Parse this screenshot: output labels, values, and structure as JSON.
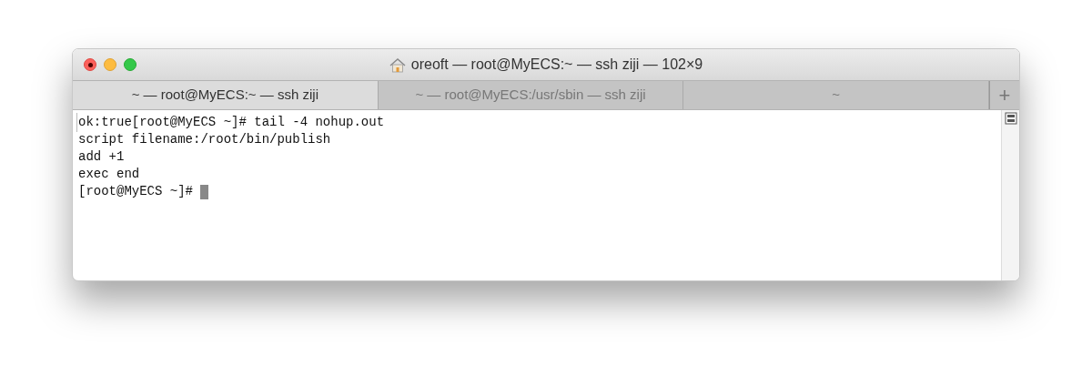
{
  "window": {
    "title": "oreoft — root@MyECS:~ — ssh ziji — 102×9"
  },
  "tabs": [
    {
      "label": "~ — root@MyECS:~ — ssh ziji",
      "selected": true
    },
    {
      "label": "~ — root@MyECS:/usr/sbin — ssh ziji",
      "selected": false
    },
    {
      "label": "~",
      "selected": false
    }
  ],
  "new_tab": "+",
  "terminal": {
    "lines": [
      {
        "text": "ok:true[root@MyECS ~]# tail -4 nohup.out",
        "marked": true
      },
      {
        "text": "script filename:/root/bin/publish",
        "marked": false
      },
      {
        "text": "add +1",
        "marked": false
      },
      {
        "text": "exec end",
        "marked": false
      },
      {
        "text": "[root@MyECS ~]# ",
        "marked": false
      }
    ]
  }
}
